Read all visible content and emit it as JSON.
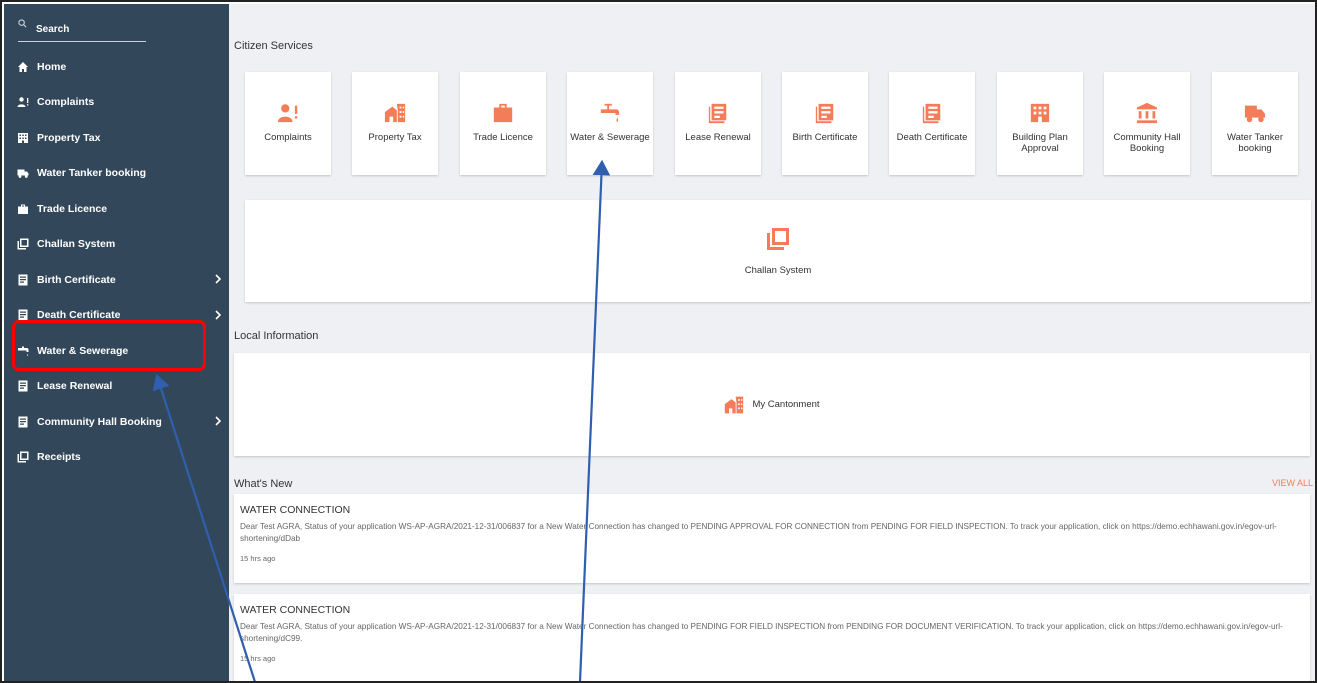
{
  "sidebar": {
    "search_label": "Search",
    "items": [
      {
        "label": "Home",
        "icon": "home-icon"
      },
      {
        "label": "Complaints",
        "icon": "complaints-icon"
      },
      {
        "label": "Property Tax",
        "icon": "property-tax-icon"
      },
      {
        "label": "Water Tanker booking",
        "icon": "truck-icon"
      },
      {
        "label": "Trade Licence",
        "icon": "briefcase-icon"
      },
      {
        "label": "Challan System",
        "icon": "challan-icon"
      },
      {
        "label": "Birth Certificate",
        "icon": "document-icon"
      },
      {
        "label": "Death Certificate",
        "icon": "document-icon"
      },
      {
        "label": "Water & Sewerage",
        "icon": "tap-icon"
      },
      {
        "label": "Lease Renewal",
        "icon": "document-icon"
      },
      {
        "label": "Community Hall Booking",
        "icon": "document-icon"
      },
      {
        "label": "Receipts",
        "icon": "receipt-icon"
      }
    ]
  },
  "main": {
    "citizen_services_title": "Citizen Services",
    "services": [
      {
        "label": "Complaints",
        "icon": "complaints-icon"
      },
      {
        "label": "Property Tax",
        "icon": "property-tax-icon"
      },
      {
        "label": "Trade Licence",
        "icon": "briefcase-icon"
      },
      {
        "label": "Water & Sewerage",
        "icon": "tap-icon"
      },
      {
        "label": "Lease Renewal",
        "icon": "document-icon"
      },
      {
        "label": "Birth Certificate",
        "icon": "document-icon"
      },
      {
        "label": "Death Certificate",
        "icon": "document-icon"
      },
      {
        "label": "Building Plan Approval",
        "icon": "building-icon"
      },
      {
        "label": "Community Hall Booking",
        "icon": "hall-icon"
      },
      {
        "label": "Water Tanker booking",
        "icon": "truck-icon"
      }
    ],
    "challan_label": "Challan System",
    "local_information_title": "Local Information",
    "my_cantonment_label": "My Cantonment",
    "whats_new_title": "What's New",
    "view_all_label": "VIEW ALL",
    "news": [
      {
        "title": "WATER CONNECTION",
        "body": "Dear Test AGRA, Status of your application WS-AP-AGRA/2021-12-31/006837 for a New Water Connection has changed to PENDING APPROVAL FOR CONNECTION from PENDING FOR FIELD INSPECTION. To track your application, click on https://demo.echhawani.gov.in/egov-url-shortening/dDab",
        "time": "15 hrs ago"
      },
      {
        "title": "WATER CONNECTION",
        "body": "Dear Test AGRA, Status of your application WS-AP-AGRA/2021-12-31/006837 for a New Water Connection has changed to PENDING FOR FIELD INSPECTION from PENDING FOR DOCUMENT VERIFICATION. To track your application, click on https://demo.echhawani.gov.in/egov-url-shortening/dC99.",
        "time": "15 hrs ago"
      }
    ]
  },
  "colors": {
    "sidebar_bg": "#33475a",
    "accent": "#f47c58",
    "annotation_box": "#ff0000",
    "annotation_arrow": "#2f5fae"
  }
}
